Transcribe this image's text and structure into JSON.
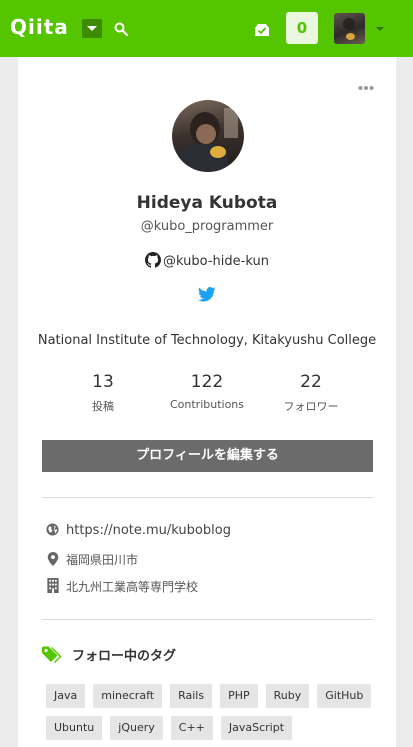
{
  "header": {
    "logo_text": "Qiita",
    "notification_count": "0",
    "bg_color": "#55c500"
  },
  "profile": {
    "name": "Hideya Kubota",
    "handle": "@kubo_programmer",
    "github": "@kubo-hide-kun",
    "organization": "National Institute of Technology, Kitakyushu College",
    "stats": [
      {
        "value": "13",
        "label": "投稿"
      },
      {
        "value": "122",
        "label": "Contributions"
      },
      {
        "value": "22",
        "label": "フォロワー"
      }
    ],
    "edit_button": "プロフィールを編集する"
  },
  "info": {
    "website": "https://note.mu/kuboblog",
    "location": "福岡県田川市",
    "organization": "北九州工業高等専門学校"
  },
  "tags_section": {
    "title": "フォロー中のタグ",
    "tags": [
      "Java",
      "minecraft",
      "Rails",
      "PHP",
      "Ruby",
      "GitHub",
      "Ubuntu",
      "jQuery",
      "C++",
      "JavaScript"
    ]
  },
  "icons": [
    "dropdown-icon",
    "search-icon",
    "inbox-icon",
    "more-icon",
    "github-icon",
    "twitter-icon",
    "globe-icon",
    "location-pin-icon",
    "building-icon",
    "tags-icon"
  ]
}
